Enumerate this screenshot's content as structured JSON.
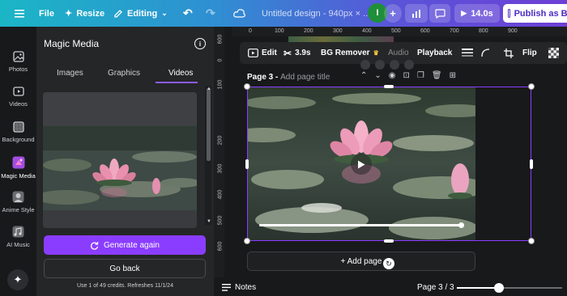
{
  "topbar": {
    "file_label": "File",
    "resize_label": "Resize",
    "editing_label": "Editing",
    "doc_title": "Untitled design - 940px × ...",
    "avatar_initial": "I",
    "add_symbol": "+",
    "duration_label": "14.0s",
    "publish_label": "Publish as Bra"
  },
  "rail": {
    "items": [
      {
        "label": "Photos"
      },
      {
        "label": "Videos"
      },
      {
        "label": "Background"
      },
      {
        "label": "Magic Media"
      },
      {
        "label": "Anime Style"
      },
      {
        "label": "AI Music"
      }
    ],
    "active_index": 3
  },
  "panel": {
    "title": "Magic Media",
    "tabs": [
      {
        "label": "Images"
      },
      {
        "label": "Graphics"
      },
      {
        "label": "Videos"
      }
    ],
    "active_tab": "Videos",
    "generate_label": "Generate again",
    "go_back_label": "Go back",
    "credits_text": "Use 1 of 49 credits. Refreshes 11/1/24"
  },
  "ruler": {
    "top_ticks": [
      "0",
      "100",
      "200",
      "300",
      "400",
      "500",
      "600",
      "700",
      "800",
      "900"
    ],
    "left_ticks": [
      "600",
      "0",
      "100",
      "200",
      "300",
      "400",
      "500",
      "600"
    ]
  },
  "context_toolbar": {
    "edit_label": "Edit",
    "duration_label": "3.9s",
    "bg_remover_label": "BG Remover",
    "audio_label": "Audio",
    "playback_label": "Playback",
    "flip_label": "Flip"
  },
  "canvas": {
    "page_label": "Page 3 - ",
    "page_title_placeholder": "Add page title",
    "video_progress": 1.0,
    "add_page_label": "+ Add page"
  },
  "bottombar": {
    "notes_label": "Notes",
    "page_indicator": "Page 3 / 3",
    "zoom_fraction": 0.4
  },
  "colors": {
    "accent_purple": "#8b3dff",
    "panel_bg": "#252627",
    "app_bg": "#18191b"
  }
}
